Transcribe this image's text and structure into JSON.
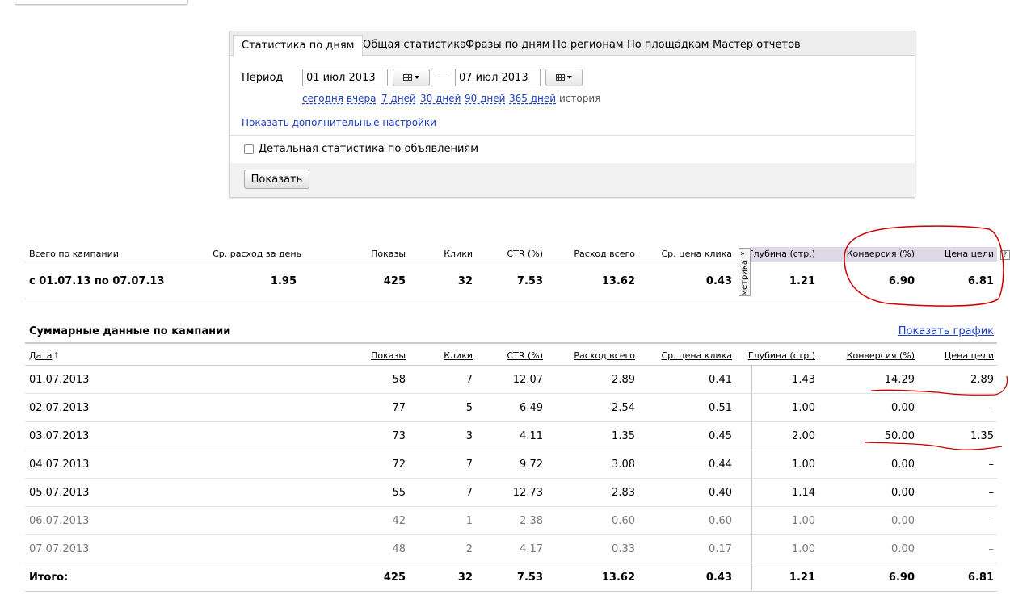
{
  "tabs": [
    "Статистика по дням",
    "Общая статистика",
    "Фразы по дням",
    "По регионам",
    "По площадкам",
    "Мастер отчетов"
  ],
  "filter": {
    "period_label": "Период",
    "date_from": "01 июл 2013",
    "date_to": "07 июл 2013",
    "dash": "—",
    "quick_links": [
      "сегодня",
      "вчера",
      "7 дней",
      "30 дней",
      "90 дней",
      "365 дней"
    ],
    "history": "история",
    "more_settings": "Показать дополнительные настройки",
    "detail_checkbox_label": "Детальная статистика по объявлениям",
    "detail_checked": false,
    "show_button": "Показать"
  },
  "summary": {
    "headers": {
      "total": "Всего по кампании",
      "avg_spend": "Ср. расход за день",
      "shows": "Показы",
      "clicks": "Клики",
      "ctr": "CTR (%)",
      "spend": "Расход всего",
      "avg_cpc": "Ср. цена клика",
      "depth": "Глубина (стр.)",
      "conversion": "Конверсия (%)",
      "goal_price": "Цена цели"
    },
    "metrika_label": "метрика",
    "help": "?",
    "row": {
      "period": "с 01.07.13 по 07.07.13",
      "avg_spend": "1.95",
      "shows": "425",
      "clicks": "32",
      "ctr": "7.53",
      "spend": "13.62",
      "avg_cpc": "0.43",
      "depth": "1.21",
      "conversion": "6.90",
      "goal_price": "6.81"
    }
  },
  "daily": {
    "title": "Суммарные данные по кампании",
    "graph_link": "Показать график",
    "headers": {
      "date": "Дата",
      "sort_arrow": "↑",
      "shows": "Показы",
      "clicks": "Клики",
      "ctr": "CTR (%)",
      "spend": "Расход всего",
      "avg_cpc": "Ср. цена клика",
      "depth": "Глубина (стр.)",
      "conversion": "Конверсия (%)",
      "goal_price": "Цена цели"
    },
    "rows": [
      {
        "date": "01.07.2013",
        "shows": "58",
        "clicks": "7",
        "ctr": "12.07",
        "spend": "2.89",
        "avg_cpc": "0.41",
        "depth": "1.43",
        "conversion": "14.29",
        "goal_price": "2.89",
        "weekend": false
      },
      {
        "date": "02.07.2013",
        "shows": "77",
        "clicks": "5",
        "ctr": "6.49",
        "spend": "2.54",
        "avg_cpc": "0.51",
        "depth": "1.00",
        "conversion": "0.00",
        "goal_price": "–",
        "weekend": false
      },
      {
        "date": "03.07.2013",
        "shows": "73",
        "clicks": "3",
        "ctr": "4.11",
        "spend": "1.35",
        "avg_cpc": "0.45",
        "depth": "2.00",
        "conversion": "50.00",
        "goal_price": "1.35",
        "weekend": false
      },
      {
        "date": "04.07.2013",
        "shows": "72",
        "clicks": "7",
        "ctr": "9.72",
        "spend": "3.08",
        "avg_cpc": "0.44",
        "depth": "1.00",
        "conversion": "0.00",
        "goal_price": "–",
        "weekend": false
      },
      {
        "date": "05.07.2013",
        "shows": "55",
        "clicks": "7",
        "ctr": "12.73",
        "spend": "2.83",
        "avg_cpc": "0.40",
        "depth": "1.14",
        "conversion": "0.00",
        "goal_price": "–",
        "weekend": false
      },
      {
        "date": "06.07.2013",
        "shows": "42",
        "clicks": "1",
        "ctr": "2.38",
        "spend": "0.60",
        "avg_cpc": "0.60",
        "depth": "1.00",
        "conversion": "0.00",
        "goal_price": "–",
        "weekend": true
      },
      {
        "date": "07.07.2013",
        "shows": "48",
        "clicks": "2",
        "ctr": "4.17",
        "spend": "0.33",
        "avg_cpc": "0.17",
        "depth": "1.00",
        "conversion": "0.00",
        "goal_price": "–",
        "weekend": true
      }
    ],
    "total": {
      "label": "Итого:",
      "shows": "425",
      "clicks": "32",
      "ctr": "7.53",
      "spend": "13.62",
      "avg_cpc": "0.43",
      "depth": "1.21",
      "conversion": "6.90",
      "goal_price": "6.81"
    }
  },
  "annotation_color": "#cc0000",
  "link_color": "#1a3dc1"
}
